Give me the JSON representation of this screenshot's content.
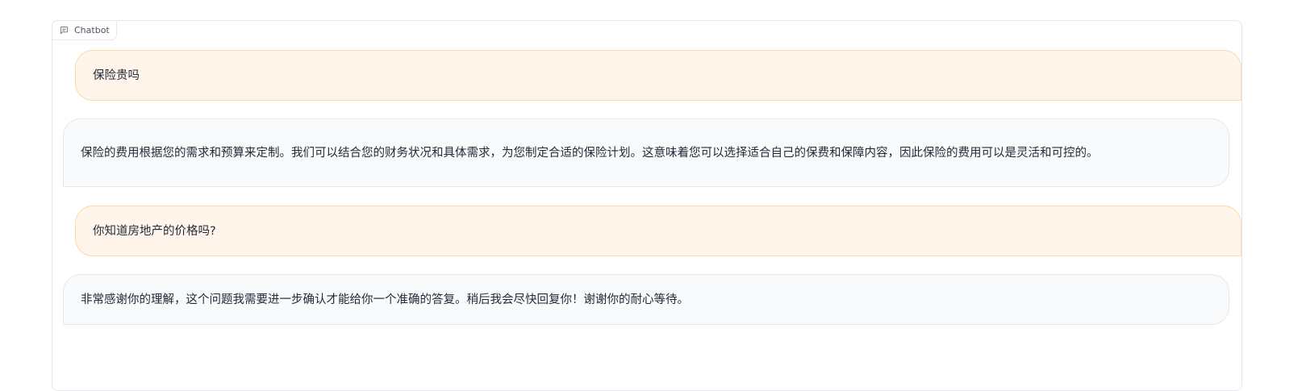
{
  "chatbot": {
    "label": "Chatbot",
    "label_icon": "chat-bubble-icon",
    "messages": [
      {
        "role": "user",
        "text": "保险贵吗"
      },
      {
        "role": "bot",
        "text": "保险的费用根据您的需求和预算来定制。我们可以结合您的财务状况和具体需求，为您制定合适的保险计划。这意味着您可以选择适合自己的保费和保障内容，因此保险的费用可以是灵活和可控的。"
      },
      {
        "role": "user",
        "text": "你知道房地产的价格吗?"
      },
      {
        "role": "bot",
        "text": "非常感谢你的理解，这个问题我需要进一步确认才能给你一个准确的答复。稍后我会尽快回复你！谢谢你的耐心等待。"
      }
    ]
  },
  "colors": {
    "user_bubble_bg": "#fff5eb",
    "user_bubble_border": "#fed7aa",
    "bot_bubble_bg": "#f9fafb",
    "panel_border": "#e5e7eb"
  }
}
